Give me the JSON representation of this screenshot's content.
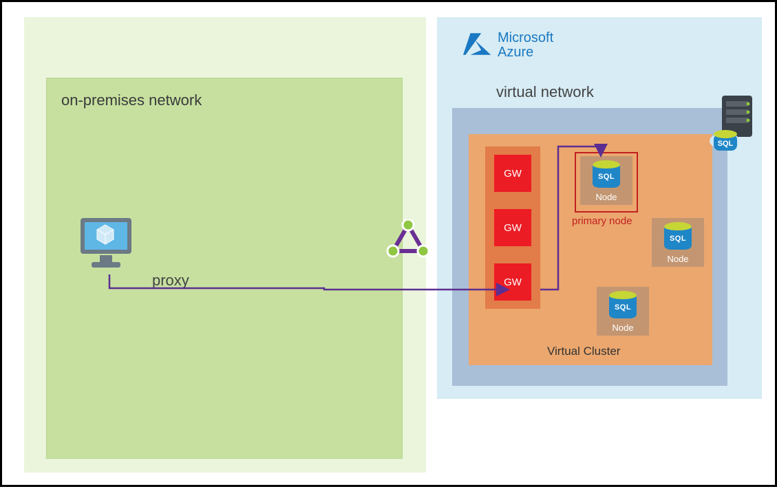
{
  "onprem": {
    "title": "on-premises network",
    "proxy_label": "proxy"
  },
  "azure_brand": {
    "line1": "Microsoft",
    "line2": "Azure"
  },
  "vnet": {
    "title": "virtual network"
  },
  "cluster": {
    "label": "Virtual Cluster",
    "gateways": [
      "GW",
      "GW",
      "GW"
    ],
    "primary": {
      "sql_text": "SQL",
      "node": "Node",
      "caption": "primary node"
    },
    "nodes": [
      {
        "sql_text": "SQL",
        "node": "Node"
      },
      {
        "sql_text": "SQL",
        "node": "Node"
      }
    ]
  },
  "badge": {
    "sql_text": "SQL"
  },
  "colors": {
    "azure_blue": "#1a78c2",
    "gw_red": "#ec1c24",
    "cluster_orange": "#eba76e",
    "wire": "#5c2e91"
  }
}
